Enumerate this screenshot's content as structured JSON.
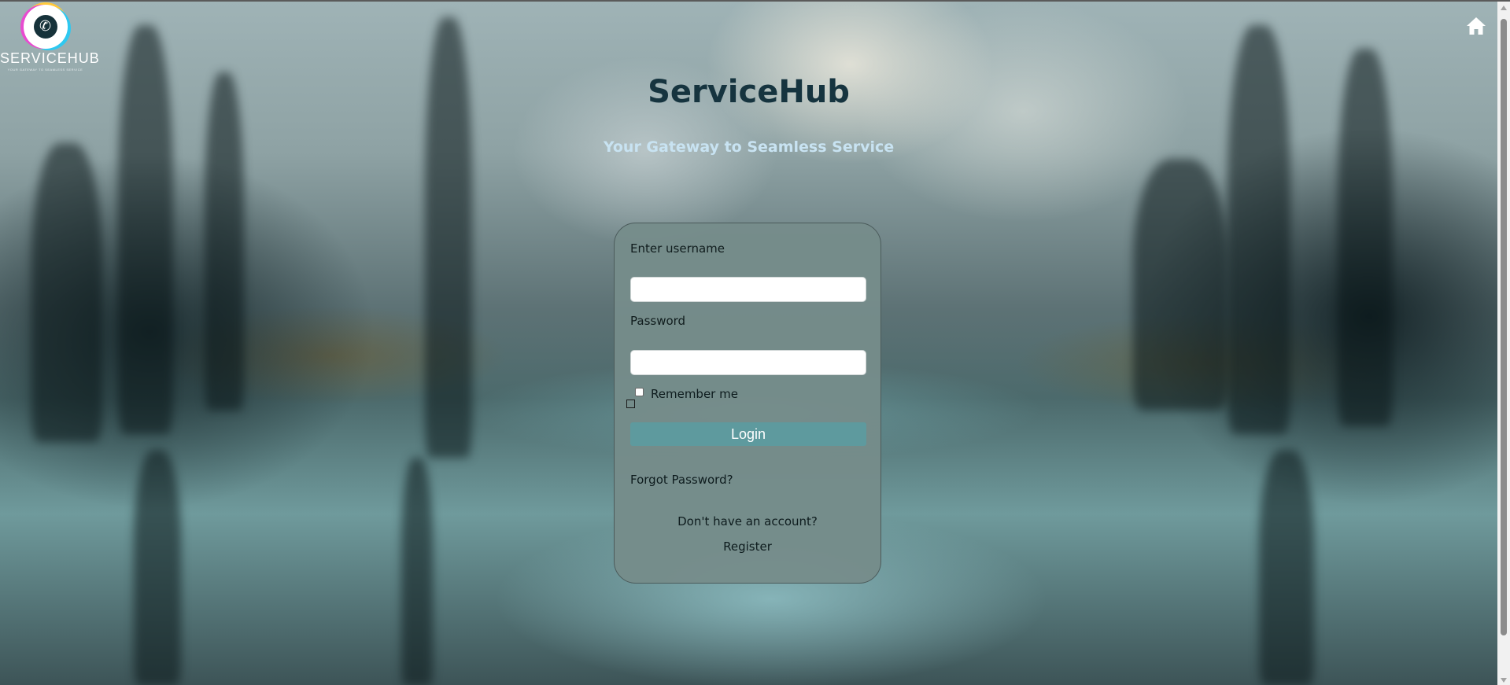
{
  "logo": {
    "name": "SERVICEHUB",
    "tagline": "YOUR GATEWAY TO SEAMLESS SERVICE",
    "icon": "phone-headset-icon"
  },
  "header": {
    "home_icon": "home-icon"
  },
  "main": {
    "title": "ServiceHub",
    "subtitle": "Your Gateway to Seamless Service"
  },
  "login_form": {
    "username_label": "Enter username",
    "username_value": "",
    "password_label": "Password",
    "password_value": "",
    "remember_label": "Remember me",
    "remember_checked": false,
    "login_button": "Login",
    "forgot_password": "Forgot Password?",
    "no_account": "Don't have an account?",
    "register": "Register"
  },
  "colors": {
    "title": "#16343f",
    "subtitle": "#c8e3f2",
    "card_background": "#768c8a",
    "login_button": "#5e9a9e"
  }
}
